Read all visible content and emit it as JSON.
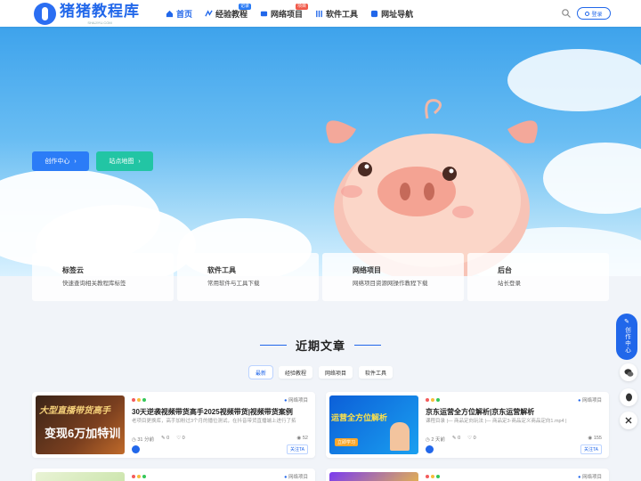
{
  "header": {
    "logo_title": "猪猪教程库",
    "logo_sub": "SHAJIYU.COM",
    "nav": [
      {
        "label": "首页",
        "icon": "home-icon",
        "active": true,
        "badge": ""
      },
      {
        "label": "经验教程",
        "icon": "tutorial-icon",
        "active": false,
        "badge": "记录"
      },
      {
        "label": "网络项目",
        "icon": "project-icon",
        "active": false,
        "badge": "项目"
      },
      {
        "label": "软件工具",
        "icon": "tools-icon",
        "active": false,
        "badge": ""
      },
      {
        "label": "网址导航",
        "icon": "nav-site-icon",
        "active": false,
        "badge": ""
      }
    ],
    "login_label": "登录"
  },
  "hero": {
    "btn_create": "创作中心",
    "btn_sitemap": "站点地图"
  },
  "features": [
    {
      "title": "标签云",
      "desc": "快速查询相关教程库标签"
    },
    {
      "title": "软件工具",
      "desc": "常用软件与工具下载"
    },
    {
      "title": "网络项目",
      "desc": "网络项目资源网操作教程下载"
    },
    {
      "title": "后台",
      "desc": "站长登录"
    }
  ],
  "section": {
    "title": "近期文章",
    "tabs": [
      "最新",
      "经验教程",
      "网络项目",
      "软件工具"
    ]
  },
  "articles": [
    {
      "thumb_text_1": "大型直播带货高手",
      "thumb_text_2": "变现6万加特训",
      "category": "网络项目",
      "title": "30天逆袭视频带货高手2025视频带货|视频带货案例",
      "excerpt": "老项目更换库，高手加粉过3个月的播位测试，在抖音带货直播端上进行了拓",
      "time": "31 分前",
      "comments": "0",
      "likes": "0",
      "views": "52",
      "follow": "关注TA"
    },
    {
      "thumb_text_1": "运营全方位解析",
      "thumb_text_2": "立即学习",
      "category": "网络项目",
      "title": "京东运营全方位解析|京东运营解析",
      "excerpt": "课程目录 |— 商品定向玩法 |— 商品定3-商品定义商品定向1.mp4 |",
      "time": "2 天前",
      "comments": "0",
      "likes": "0",
      "views": "155",
      "follow": "关注TA"
    },
    {
      "category": "网络项目"
    },
    {
      "category": "网络项目"
    }
  ],
  "float": {
    "create_label": "创作中心",
    "wechat_icon": "wechat-icon",
    "qq_icon": "qq-icon",
    "close_icon": "close-icon"
  },
  "colors": {
    "primary": "#2167ea",
    "create_btn": "#2b7cf7",
    "sitemap_btn": "#22c5a4"
  }
}
